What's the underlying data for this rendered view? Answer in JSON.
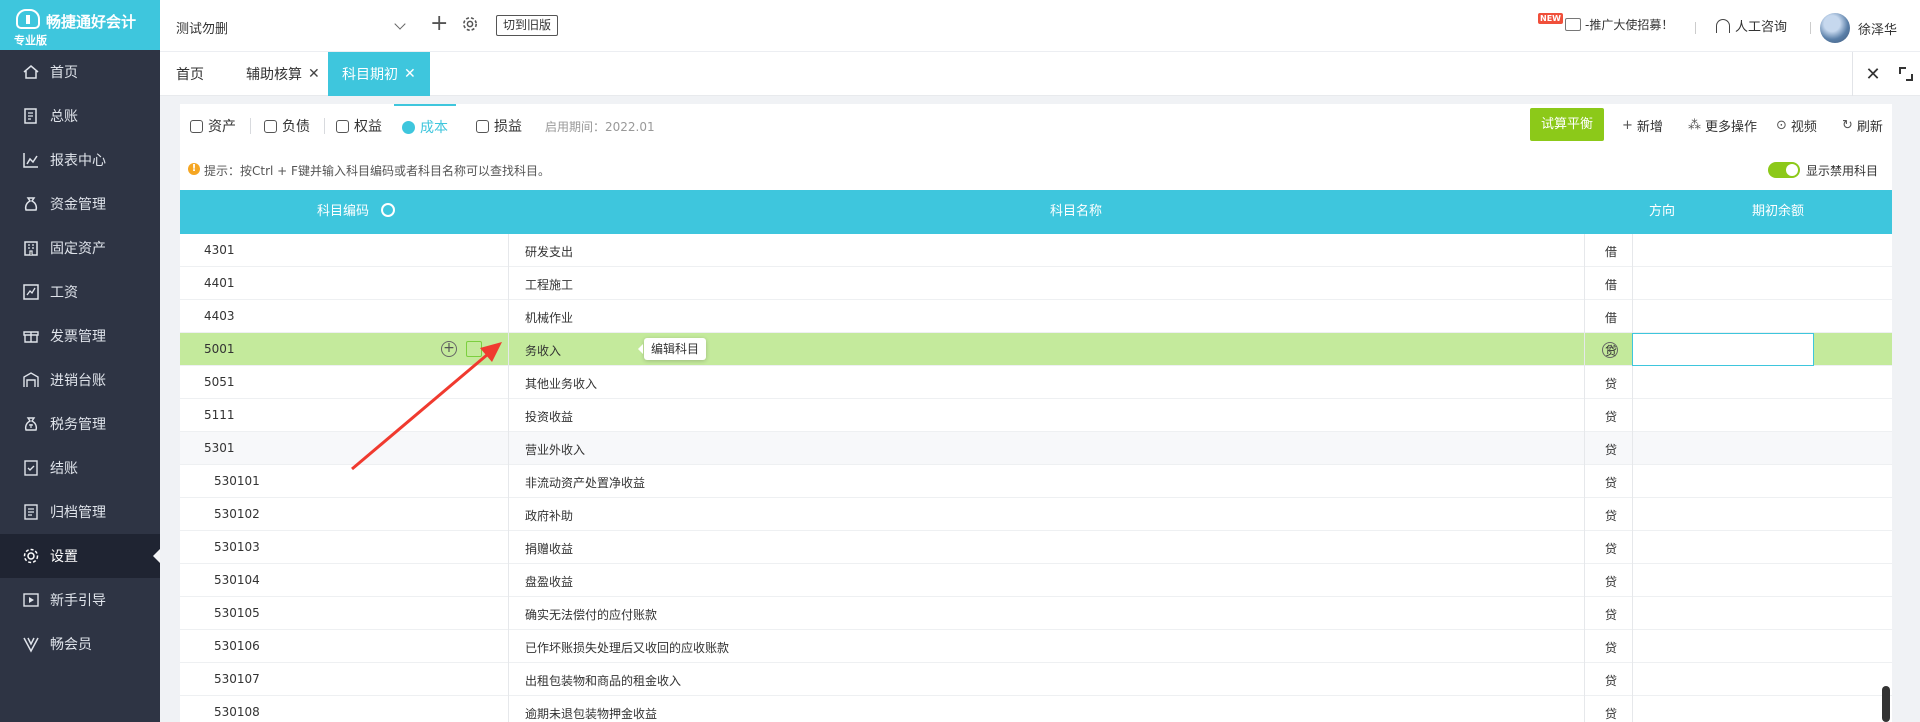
{
  "brand": {
    "name": "畅捷通好会计",
    "edition": "专业版"
  },
  "sidebar": {
    "items": [
      {
        "label": "首页",
        "icon": "home-icon"
      },
      {
        "label": "总账",
        "icon": "ledger-icon"
      },
      {
        "label": "报表中心",
        "icon": "chart-icon"
      },
      {
        "label": "资金管理",
        "icon": "money-bag-icon"
      },
      {
        "label": "固定资产",
        "icon": "building-icon"
      },
      {
        "label": "工资",
        "icon": "salary-icon"
      },
      {
        "label": "发票管理",
        "icon": "invoice-icon"
      },
      {
        "label": "进销台账",
        "icon": "inventory-icon"
      },
      {
        "label": "税务管理",
        "icon": "tax-icon"
      },
      {
        "label": "结账",
        "icon": "checkout-icon"
      },
      {
        "label": "归档管理",
        "icon": "archive-icon"
      },
      {
        "label": "设置",
        "icon": "gear-icon",
        "active": true
      },
      {
        "label": "新手引导",
        "icon": "guide-icon"
      },
      {
        "label": "畅会员",
        "icon": "vip-icon"
      }
    ]
  },
  "header": {
    "account": "测试勿删",
    "old_version_label": "切到旧版",
    "new_badge": "NEW",
    "promo": "-推广大使招募！",
    "service": "人工咨询",
    "user_name": "徐泽华"
  },
  "pagetabs": [
    {
      "label": "首页"
    },
    {
      "label": "辅助核算",
      "closable": true
    },
    {
      "label": "科目期初",
      "closable": true,
      "active": true
    }
  ],
  "subtabs": [
    {
      "label": "资产"
    },
    {
      "label": "负债"
    },
    {
      "label": "权益"
    },
    {
      "label": "成本",
      "active": true
    },
    {
      "label": "损益"
    }
  ],
  "period": "启用期间：2022.01",
  "toolbar": {
    "trial_balance": "试算平衡",
    "add": "新增",
    "more": "更多操作",
    "video": "视频",
    "refresh": "刷新"
  },
  "tip": "提示：按Ctrl + F键并输入科目编码或者科目名称可以查找科目。",
  "toggle_label": "显示禁用科目",
  "table": {
    "headers": {
      "code": "科目编码",
      "name": "科目名称",
      "direction": "方向",
      "balance": "期初余额"
    },
    "rows": [
      {
        "code": "4301",
        "name": "研发支出",
        "dir": "借"
      },
      {
        "code": "4401",
        "name": "工程施工",
        "dir": "借"
      },
      {
        "code": "4403",
        "name": "机械作业",
        "dir": "借"
      },
      {
        "code": "5001",
        "name": "务收入",
        "dir": "贷"
      },
      {
        "code": "5051",
        "name": "其他业务收入",
        "dir": "贷"
      },
      {
        "code": "5111",
        "name": "投资收益",
        "dir": "贷"
      },
      {
        "code": "5301",
        "name": "营业外收入",
        "dir": "贷"
      },
      {
        "code": "530101",
        "name": "非流动资产处置净收益",
        "dir": "贷"
      },
      {
        "code": "530102",
        "name": "政府补助",
        "dir": "贷"
      },
      {
        "code": "530103",
        "name": "捐赠收益",
        "dir": "贷"
      },
      {
        "code": "530104",
        "name": "盘盈收益",
        "dir": "贷"
      },
      {
        "code": "530105",
        "name": "确实无法偿付的应付账款",
        "dir": "贷"
      },
      {
        "code": "530106",
        "name": "已作坏账损失处理后又收回的应收账款",
        "dir": "贷"
      },
      {
        "code": "530107",
        "name": "出租包装物和商品的租金收入",
        "dir": "贷"
      },
      {
        "code": "530108",
        "name": "逾期未退包装物押金收益",
        "dir": "贷"
      }
    ]
  },
  "tooltip": "编辑科目",
  "colors": {
    "accent": "#3ec6dd",
    "sidebar": "#2e3444",
    "green": "#8cc919",
    "highlight_row": "#c4ea9c",
    "arrow": "#f03a2f"
  }
}
